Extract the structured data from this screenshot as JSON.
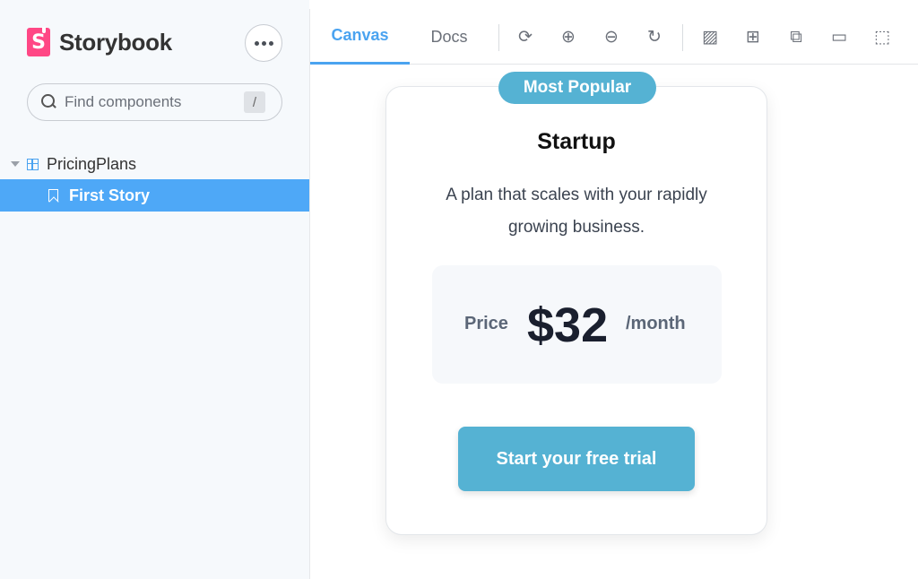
{
  "sidebar": {
    "brand": {
      "logo_letter": "S",
      "name": "Storybook"
    },
    "menu_button": "more-options",
    "search": {
      "placeholder": "Find components",
      "shortcut": "/"
    },
    "tree": {
      "group": {
        "label": "PricingPlans",
        "icon": "component-grid-icon"
      },
      "items": [
        {
          "label": "First Story",
          "icon": "bookmark-icon",
          "selected": true
        }
      ]
    }
  },
  "toolbar": {
    "tabs": [
      {
        "label": "Canvas",
        "active": true
      },
      {
        "label": "Docs",
        "active": false
      }
    ],
    "tools": [
      {
        "name": "reload-icon",
        "glyph": "⟳"
      },
      {
        "name": "zoom-in-icon",
        "glyph": "⊕"
      },
      {
        "name": "zoom-out-icon",
        "glyph": "⊖"
      },
      {
        "name": "zoom-reset-icon",
        "glyph": "↻"
      },
      {
        "name": "background-icon",
        "glyph": "▨"
      },
      {
        "name": "grid-icon",
        "glyph": "⊞"
      },
      {
        "name": "viewport-icon",
        "glyph": "⧉"
      },
      {
        "name": "measure-icon",
        "glyph": "▭"
      },
      {
        "name": "outline-icon",
        "glyph": "⬚"
      }
    ]
  },
  "card": {
    "badge": "Most Popular",
    "plan_name": "Startup",
    "description": "A plan that scales with your rapidly growing business.",
    "price_label": "Price",
    "price_value": "$32",
    "price_period": "/month",
    "cta_label": "Start your free trial"
  },
  "colors": {
    "accent": "#4aa3f0",
    "brand": "#ff4785",
    "card_accent": "#55b2d3",
    "selected_row": "#4ea8f7"
  }
}
